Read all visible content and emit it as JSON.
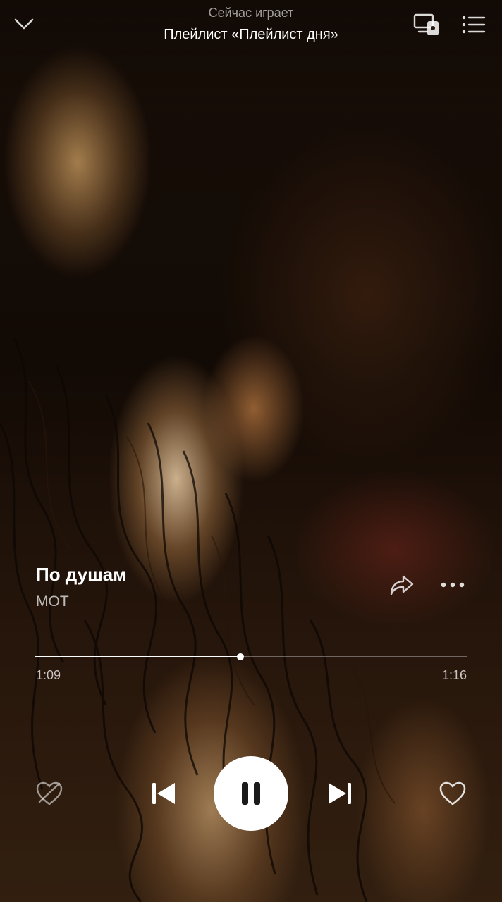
{
  "header": {
    "subtitle": "Сейчас играет",
    "title": "Плейлист «Плейлист дня»",
    "icons": {
      "collapse": "chevron-down-icon",
      "device": "devices-icon",
      "queue": "queue-list-icon"
    }
  },
  "track": {
    "title": "По душам",
    "artist": "МОТ"
  },
  "progress": {
    "elapsed": "1:09",
    "total": "1:16",
    "fraction": 0.475
  },
  "controls": {
    "icons": [
      "dislike-icon",
      "previous-icon",
      "pause-icon",
      "next-icon",
      "heart-icon"
    ]
  },
  "colors": {
    "accent": "#ffffff",
    "muted_text": "#b3b3b3"
  }
}
